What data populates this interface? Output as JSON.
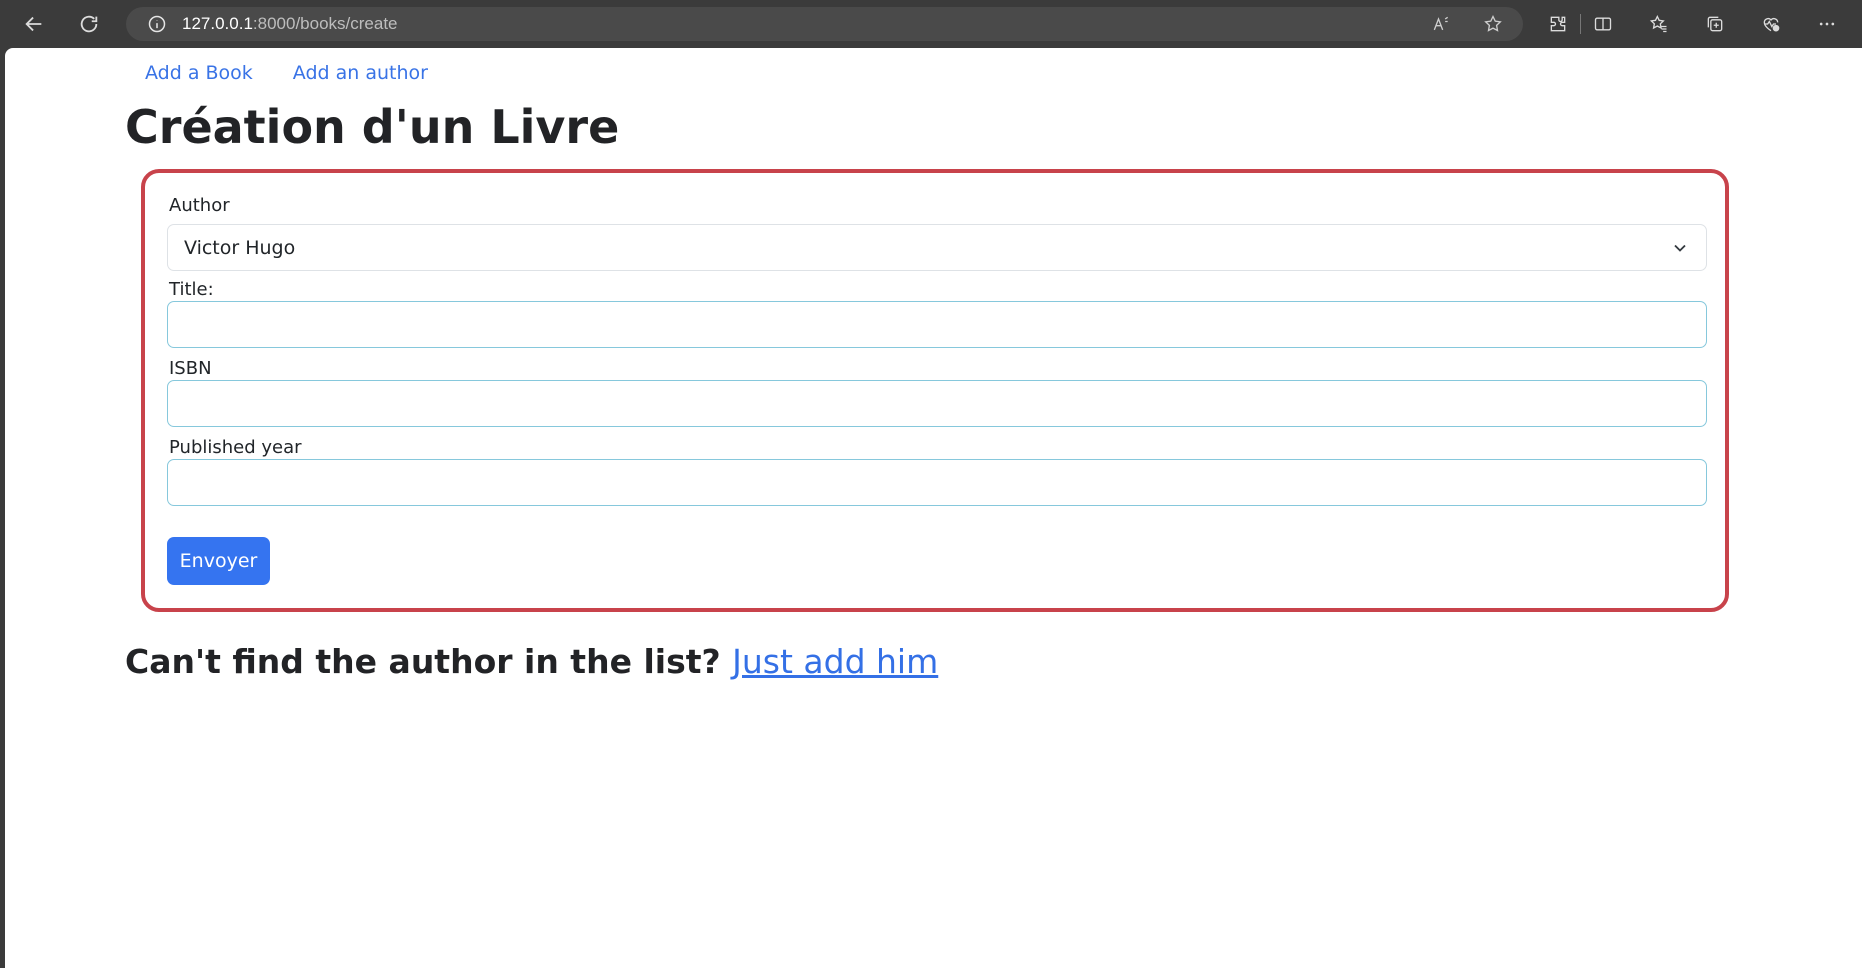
{
  "browser": {
    "url_host": "127.0.0.1",
    "url_path": ":8000/books/create"
  },
  "nav": {
    "links": [
      "Add a Book",
      "Add an author"
    ]
  },
  "page": {
    "title": "Création d'un Livre"
  },
  "form": {
    "author_label": "Author",
    "author_selected": "Victor Hugo",
    "title_label": "Title:",
    "title_value": "",
    "isbn_label": "ISBN",
    "isbn_value": "",
    "year_label": "Published year",
    "year_value": "",
    "submit_label": "Envoyer"
  },
  "footer": {
    "question": "Can't find the author in the list?",
    "link": "Just add him"
  },
  "colors": {
    "accent": "#3574f0",
    "card_border": "#c8434b",
    "link": "#3973e6"
  }
}
